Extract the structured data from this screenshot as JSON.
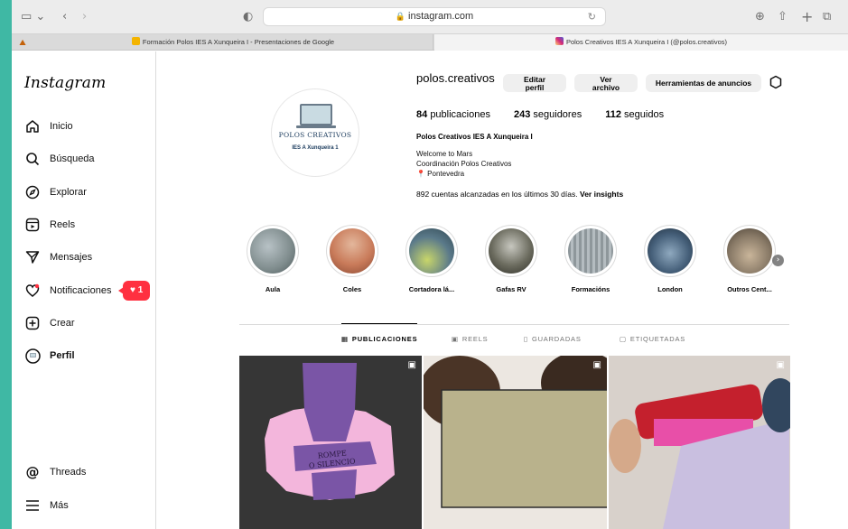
{
  "browser": {
    "address": "instagram.com",
    "tabs": [
      {
        "label": "Formación Polos IES A Xunqueira I - Presentaciones de Google",
        "fav_color": "#f4b400"
      },
      {
        "label": "Polos Creativos IES A Xunqueira I (@polos.creativos)",
        "fav_color": "#d6249f"
      }
    ]
  },
  "sidebar": {
    "logo": "Instagram",
    "items": [
      {
        "label": "Inicio",
        "icon": "home-icon"
      },
      {
        "label": "Búsqueda",
        "icon": "search-icon"
      },
      {
        "label": "Explorar",
        "icon": "compass-icon"
      },
      {
        "label": "Reels",
        "icon": "reels-icon"
      },
      {
        "label": "Mensajes",
        "icon": "send-icon"
      },
      {
        "label": "Notificaciones",
        "icon": "heart-icon"
      },
      {
        "label": "Crear",
        "icon": "plus-square-icon"
      },
      {
        "label": "Perfil",
        "icon": "avatar-icon"
      }
    ],
    "bottom_items": [
      {
        "label": "Threads",
        "icon": "threads-icon"
      },
      {
        "label": "Más",
        "icon": "menu-icon"
      }
    ],
    "notification_count": "1"
  },
  "profile": {
    "avatar_text1": "POLOS CREATIVOS",
    "avatar_text2": "IES A Xunqueira 1",
    "username": "polos.creativos",
    "buttons": {
      "edit": "Editar perfil",
      "archive": "Ver archivo",
      "tools": "Herramientas de anuncios"
    },
    "stats": {
      "posts": "84",
      "posts_label": "publicaciones",
      "followers": "243",
      "followers_label": "seguidores",
      "following": "112",
      "following_label": "seguidos"
    },
    "full_name": "Polos Creativos IES A Xunqueira I",
    "bio": [
      "Welcome to Mars",
      "Coordinación Polos Creativos",
      "📍 Pontevedra"
    ],
    "insights_text": "892 cuentas alcanzadas en los últimos 30 días.",
    "insights_link": "Ver insights"
  },
  "highlights": [
    {
      "label": "Aula",
      "color": "#7f8c8d"
    },
    {
      "label": "Coles",
      "color": "#c97b5a"
    },
    {
      "label": "Cortadora lá...",
      "color": "#5b7a8a"
    },
    {
      "label": "Gafas RV",
      "color": "#6b6b5e"
    },
    {
      "label": "Formacións",
      "color": "#9aa3a8"
    },
    {
      "label": "London",
      "color": "#46607a"
    },
    {
      "label": "Outros Cent...",
      "color": "#8a7b68"
    }
  ],
  "post_tabs": [
    "PUBLICACIONES",
    "REELS",
    "GUARDADAS",
    "ETIQUETADAS"
  ]
}
